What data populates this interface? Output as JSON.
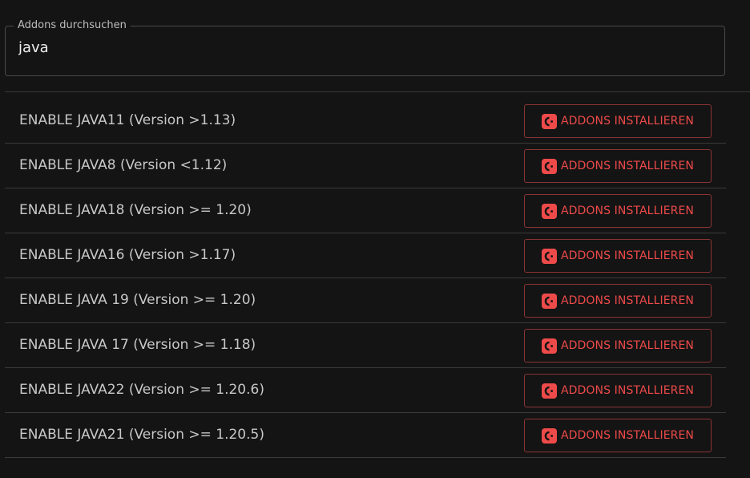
{
  "search": {
    "legend": "Addons durchsuchen",
    "value": "java"
  },
  "addons": [
    {
      "label": "ENABLE JAVA11 (Version >1.13)",
      "button": "ADDONS INSTALLIEREN"
    },
    {
      "label": "ENABLE JAVA8 (Version <1.12)",
      "button": "ADDONS INSTALLIEREN"
    },
    {
      "label": "ENABLE JAVA18 (Version >= 1.20)",
      "button": "ADDONS INSTALLIEREN"
    },
    {
      "label": "ENABLE JAVA16 (Version >1.17)",
      "button": "ADDONS INSTALLIEREN"
    },
    {
      "label": "ENABLE JAVA 19 (Version >= 1.20)",
      "button": "ADDONS INSTALLIEREN"
    },
    {
      "label": "ENABLE JAVA 17 (Version >= 1.18)",
      "button": "ADDONS INSTALLIEREN"
    },
    {
      "label": "ENABLE JAVA22 (Version >= 1.20.6)",
      "button": "ADDONS INSTALLIEREN"
    },
    {
      "label": "ENABLE JAVA21 (Version >= 1.20.5)",
      "button": "ADDONS INSTALLIEREN"
    }
  ],
  "icons": {
    "install": "addon-install-icon"
  },
  "colors": {
    "background": "#141414",
    "accent": "#ee4a4a",
    "button_border": "#8a3434",
    "divider": "#3a3a3a"
  }
}
